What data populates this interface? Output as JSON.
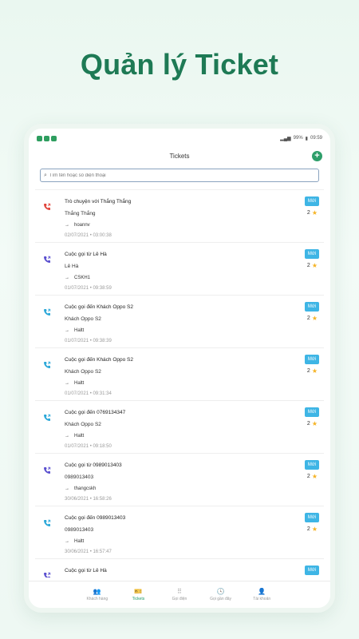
{
  "hero": {
    "title": "Quản lý Ticket"
  },
  "status_bar": {
    "battery": "99%",
    "time": "09:59"
  },
  "app_bar": {
    "title": "Tickets",
    "add_label": "+"
  },
  "search": {
    "placeholder": "Tìm tên hoặc số điện thoại"
  },
  "tickets": [
    {
      "title": "Trò chuyện với Thắng Thắng",
      "contact": "Thắng Thắng",
      "arrow": "→",
      "assignee": "hoannv",
      "date": "02/07/2021 • 03:00:38",
      "badge": "Mới",
      "rating": "2",
      "icon_color": "#e0443b"
    },
    {
      "title": "Cuộc gọi từ Lê Hà",
      "contact": "Lê Hà",
      "arrow": "→",
      "assignee": "CSKH1",
      "date": "01/07/2021 • 09:38:59",
      "badge": "Mới",
      "rating": "2",
      "icon_color": "#5a4fcf"
    },
    {
      "title": "Cuộc gọi đến Khách Oppo S2",
      "contact": "Khách Oppo S2",
      "arrow": "→",
      "assignee": "Haltt",
      "date": "01/07/2021 • 09:38:39",
      "badge": "Mới",
      "rating": "2",
      "icon_color": "#2aa7d8"
    },
    {
      "title": "Cuộc gọi đến Khách Oppo S2",
      "contact": "Khách Oppo S2",
      "arrow": "→",
      "assignee": "Haltt",
      "date": "01/07/2021 • 09:31:34",
      "badge": "Mới",
      "rating": "2",
      "icon_color": "#2aa7d8"
    },
    {
      "title": "Cuộc gọi đến 0769134347",
      "contact": "Khách Oppo S2",
      "arrow": "→",
      "assignee": "Haltt",
      "date": "01/07/2021 • 09:18:50",
      "badge": "Mới",
      "rating": "2",
      "icon_color": "#2aa7d8"
    },
    {
      "title": "Cuộc gọi từ 0989013403",
      "contact": "0989013403",
      "arrow": "→",
      "assignee": "thangcskh",
      "date": "30/06/2021 • 16:58:26",
      "badge": "Mới",
      "rating": "2",
      "icon_color": "#5a4fcf"
    },
    {
      "title": "Cuộc gọi đến 0989013403",
      "contact": "0989013403",
      "arrow": "→",
      "assignee": "Haltt",
      "date": "30/06/2021 • 16:57:47",
      "badge": "Mới",
      "rating": "2",
      "icon_color": "#2aa7d8"
    },
    {
      "title": "Cuộc gọi từ Lê Hà",
      "contact": "",
      "arrow": "",
      "assignee": "",
      "date": "",
      "badge": "Mới",
      "rating": "",
      "icon_color": "#5a4fcf"
    }
  ],
  "bottom_nav": [
    {
      "label": "Khách hàng",
      "icon": "people-icon",
      "glyph": "👥",
      "active": false
    },
    {
      "label": "Tickets",
      "icon": "ticket-icon",
      "glyph": "🎫",
      "active": true
    },
    {
      "label": "Gọi điện",
      "icon": "dialpad-icon",
      "glyph": "⠿",
      "active": false
    },
    {
      "label": "Gọi gần đây",
      "icon": "clock-icon",
      "glyph": "🕓",
      "active": false
    },
    {
      "label": "Tài khoản",
      "icon": "person-icon",
      "glyph": "👤",
      "active": false
    }
  ],
  "colors": {
    "brand": "#1e7a55",
    "accent": "#2e9e6a",
    "badge": "#3eb5e5",
    "star": "#f5b324"
  }
}
